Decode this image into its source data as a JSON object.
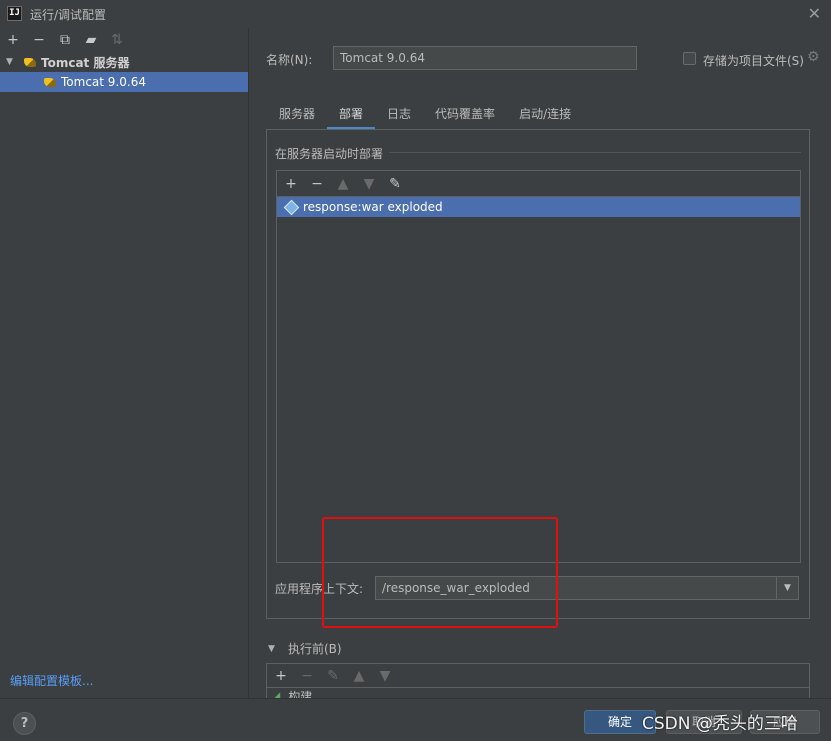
{
  "window": {
    "title": "运行/调试配置",
    "logo_text": "IJ",
    "close_glyph": "✕"
  },
  "left": {
    "toolbar": [
      {
        "name": "add-icon",
        "glyph": "+",
        "enabled": true
      },
      {
        "name": "remove-icon",
        "glyph": "−",
        "enabled": true
      },
      {
        "name": "copy-icon",
        "glyph": "⧉",
        "enabled": true
      },
      {
        "name": "folder-icon",
        "glyph": "▰",
        "enabled": true
      },
      {
        "name": "sort-icon",
        "glyph": "⇅",
        "enabled": false
      }
    ],
    "tree": {
      "parent_label": "Tomcat 服务器",
      "child_label": "Tomcat 9.0.64"
    },
    "edit_templates_link": "编辑配置模板..."
  },
  "form": {
    "name_label": "名称(N):",
    "name_value": "Tomcat 9.0.64",
    "store_label": "存储为项目文件(S)"
  },
  "tabs": [
    {
      "label": "服务器",
      "active": false
    },
    {
      "label": "部署",
      "active": true
    },
    {
      "label": "日志",
      "active": false
    },
    {
      "label": "代码覆盖率",
      "active": false
    },
    {
      "label": "启动/连接",
      "active": false
    }
  ],
  "deploy": {
    "group_title": "在服务器启动时部署",
    "artifact": "response:war exploded",
    "context_label": "应用程序上下文:",
    "context_value": "/response_war_exploded"
  },
  "before_launch": {
    "label": "执行前(B)",
    "item": "构建"
  },
  "buttons": {
    "help": "?",
    "ok": "确定",
    "cancel": "取消",
    "apply": "应用"
  },
  "watermark": "CSDN @秃头的三哈",
  "colors": {
    "selection": "#4b6eaf",
    "accent": "#4a88c7",
    "annotation": "#e01010"
  }
}
